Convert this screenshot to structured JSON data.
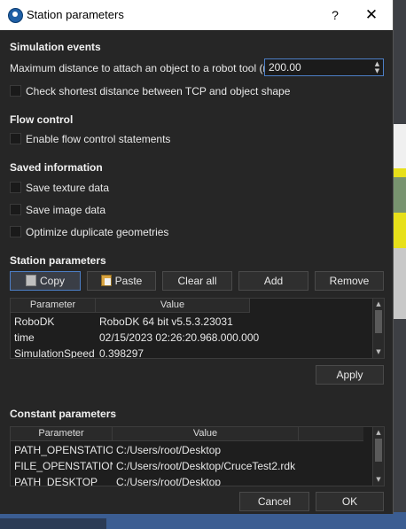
{
  "window": {
    "title": "Station parameters",
    "help": "?",
    "close": "✕"
  },
  "simulation_events": {
    "heading": "Simulation events",
    "max_distance_label": "Maximum distance to attach an object to a robot tool (mm)",
    "max_distance_value": "200.00",
    "check_shortest_label": "Check shortest distance between TCP and object shape"
  },
  "flow_control": {
    "heading": "Flow control",
    "enable_flow_label": "Enable flow control statements"
  },
  "saved_information": {
    "heading": "Saved information",
    "items": [
      "Save texture data",
      "Save image data",
      "Optimize duplicate geometries"
    ]
  },
  "station_parameters": {
    "heading": "Station parameters",
    "buttons": {
      "copy": "Copy",
      "paste": "Paste",
      "clear_all": "Clear all",
      "add": "Add",
      "remove": "Remove",
      "apply": "Apply"
    },
    "columns": [
      "Parameter",
      "Value"
    ],
    "rows": [
      [
        "RoboDK",
        "RoboDK 64 bit v5.5.3.23031"
      ],
      [
        "time",
        "02/15/2023 02:26:20.968.000.000"
      ],
      [
        "SimulationSpeed",
        "0.398297"
      ]
    ]
  },
  "constant_parameters": {
    "heading": "Constant parameters",
    "columns": [
      "Parameter",
      "Value"
    ],
    "rows": [
      [
        "PATH_OPENSTATION",
        "C:/Users/root/Desktop"
      ],
      [
        "FILE_OPENSTATION",
        "C:/Users/root/Desktop/CruceTest2.rdk"
      ],
      [
        "PATH_DESKTOP",
        "C:/Users/root/Desktop"
      ]
    ]
  },
  "footer": {
    "cancel": "Cancel",
    "ok": "OK"
  },
  "colors": {
    "dialog_bg": "#262626",
    "accent": "#4d7fc7",
    "titlebar_bg": "#ffffff"
  }
}
